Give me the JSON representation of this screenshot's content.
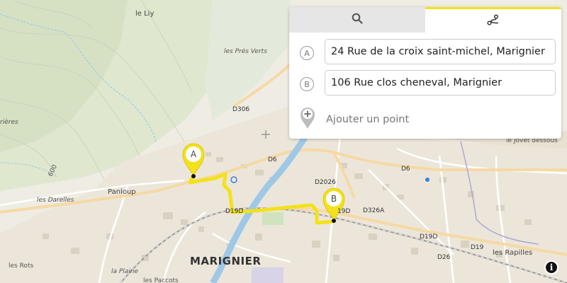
{
  "panel": {
    "tabs": [
      {
        "icon": "search-icon"
      },
      {
        "icon": "route-icon"
      }
    ],
    "point_a": {
      "letter": "A",
      "value": "24 Rue de la croix saint-michel, Marignier"
    },
    "point_b": {
      "letter": "B",
      "value": "106 Rue clos cheneval, Marignier"
    },
    "add_point_label": "Ajouter un point"
  },
  "map": {
    "place_labels": {
      "le_liy": "le Liy",
      "les_pres_verts": "les Prés Verts",
      "rieres": "rières",
      "panloup": "Panloup",
      "les_darelles": "les Darelles",
      "marignier": "MARIGNIER",
      "les_rots": "les Rots",
      "la_plaine": "la Plaine",
      "les_paccots": "les Paccots",
      "les_rapilles": "les Rapilles",
      "le_jovet_dessous": "le Jovet dessous",
      "contour_600": "600"
    },
    "road_labels": {
      "d306": "D306",
      "d6_a": "D6",
      "d6_b": "D6",
      "d2026": "D2026",
      "d19d_a": "D19D",
      "d19d_b": "19D",
      "d326a": "D326A",
      "d19d_c": "D19D",
      "d19": "D19",
      "d26": "D26"
    },
    "markers": {
      "a": "A",
      "b": "B"
    },
    "colors": {
      "route": "#f3e11b",
      "river": "#9fc8e6",
      "forest": "#dbe6cc",
      "urban": "#ebe6da"
    }
  },
  "info_button": {
    "label": "i"
  }
}
